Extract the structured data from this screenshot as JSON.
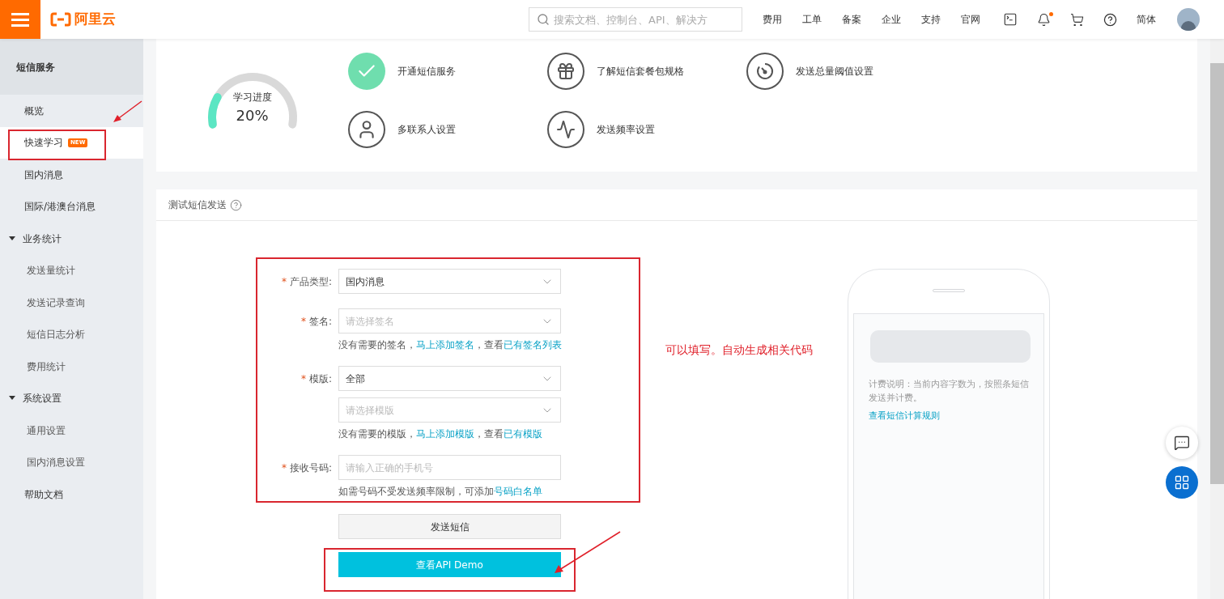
{
  "header": {
    "logo_text": "阿里云",
    "search": {
      "placeholder": "搜索文档、控制台、API、解决方"
    },
    "nav_links": [
      "费用",
      "工单",
      "备案",
      "企业",
      "支持",
      "官网"
    ],
    "notification_dot": true,
    "language": "简体"
  },
  "sidebar": {
    "title": "短信服务",
    "items": [
      {
        "kind": "item",
        "label": "概览",
        "selected": false
      },
      {
        "kind": "item",
        "label": "快速学习",
        "badge": "NEW",
        "selected": true
      },
      {
        "kind": "item",
        "label": "国内消息",
        "selected": false
      },
      {
        "kind": "item",
        "label": "国际/港澳台消息",
        "selected": false
      },
      {
        "kind": "group",
        "label": "业务统计",
        "expanded": true,
        "children": [
          {
            "label": "发送量统计",
            "selected": false
          },
          {
            "label": "发送记录查询",
            "selected": false
          },
          {
            "label": "短信日志分析",
            "selected": false
          },
          {
            "label": "费用统计",
            "selected": false
          }
        ]
      },
      {
        "kind": "group",
        "label": "系统设置",
        "expanded": true,
        "children": [
          {
            "label": "通用设置",
            "selected": false
          },
          {
            "label": "国内消息设置",
            "selected": false
          }
        ]
      },
      {
        "kind": "item",
        "label": "帮助文档",
        "selected": false
      }
    ]
  },
  "progress": {
    "label": "学习进度",
    "value": "20%",
    "steps": [
      {
        "kind": "check",
        "label": "开通短信服务",
        "done": true
      },
      {
        "kind": "gift",
        "label": "了解短信套餐包规格",
        "done": false
      },
      {
        "kind": "dial",
        "label": "发送总量阈值设置",
        "done": false
      },
      {
        "kind": "person",
        "label": "多联系人设置",
        "done": false
      },
      {
        "kind": "pulse",
        "label": "发送频率设置",
        "done": false
      }
    ]
  },
  "test_send": {
    "title": "测试短信发送",
    "rows": [
      {
        "label": "产品类型:",
        "marker": "*",
        "controls": [
          {
            "value": "国内消息"
          }
        ]
      },
      {
        "label": "签名:",
        "marker": "*",
        "controls": [
          {
            "placeholder": "请选择签名"
          }
        ],
        "hint": [
          {
            "text": "没有需要的签名，",
            "link": false
          },
          {
            "text": "马上添加签名",
            "link": true
          },
          {
            "text": "，查看",
            "link": false
          },
          {
            "text": "已有签名列表",
            "link": true
          }
        ]
      },
      {
        "label": "模版:",
        "marker": "*",
        "controls": [
          {
            "value": "全部"
          },
          {
            "placeholder": "请选择模版"
          }
        ],
        "hint": [
          {
            "text": "没有需要的模版，",
            "link": false
          },
          {
            "text": "马上添加模版",
            "link": true
          },
          {
            "text": "，查看",
            "link": false
          },
          {
            "text": "已有模版",
            "link": true
          }
        ]
      },
      {
        "label": "接收号码:",
        "marker": "*",
        "controls": [
          {
            "kind": "input",
            "placeholder": "请输入正确的手机号"
          }
        ],
        "hint": [
          {
            "text": "如需号码不受发送频率限制，可添加",
            "link": false
          },
          {
            "text": "号码白名单",
            "link": true
          }
        ]
      }
    ],
    "buttons": [
      {
        "kind": "secondary",
        "label": "发送短信"
      },
      {
        "kind": "primary",
        "label": "查看API Demo"
      }
    ],
    "phone": {
      "note": "计费说明：当前内容字数为，按照条短信发送并计费。",
      "link": "查看短信计算规则"
    }
  },
  "annotation": {
    "text": "可以填写。自动生成相关代码"
  }
}
